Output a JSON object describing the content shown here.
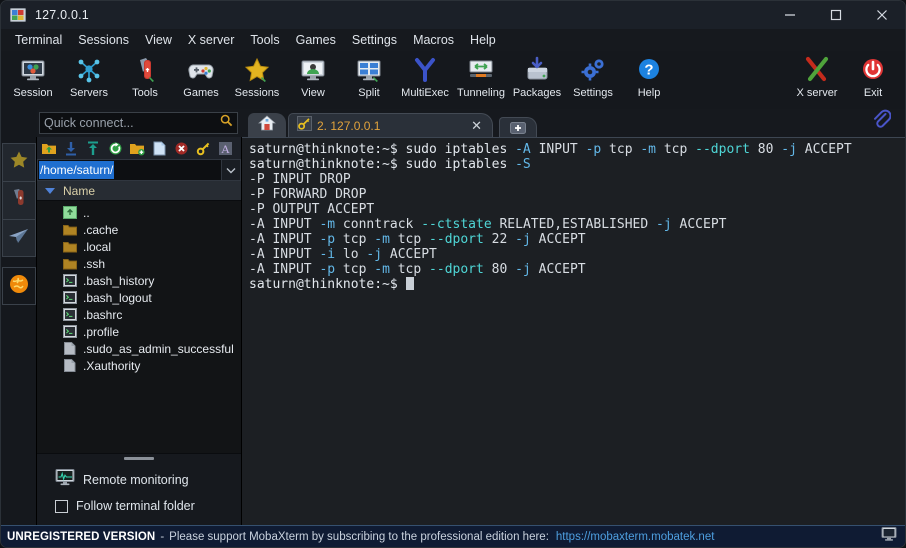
{
  "window": {
    "title": "127.0.0.1",
    "app_icon": "mobaxterm-logo-icon",
    "minimize": "—",
    "maximize": "□",
    "close": "✕"
  },
  "menubar": {
    "items": [
      {
        "label": "Terminal"
      },
      {
        "label": "Sessions"
      },
      {
        "label": "View"
      },
      {
        "label": "X server"
      },
      {
        "label": "Tools"
      },
      {
        "label": "Games"
      },
      {
        "label": "Settings"
      },
      {
        "label": "Macros"
      },
      {
        "label": "Help"
      }
    ]
  },
  "toolbar": {
    "items": [
      {
        "label": "Session",
        "icon": "monitor-session-icon"
      },
      {
        "label": "Servers",
        "icon": "servers-network-icon"
      },
      {
        "label": "Tools",
        "icon": "swiss-knife-icon"
      },
      {
        "label": "Games",
        "icon": "gamepad-icon"
      },
      {
        "label": "Sessions",
        "icon": "star-icon"
      },
      {
        "label": "View",
        "icon": "monitor-user-icon"
      },
      {
        "label": "Split",
        "icon": "split-panes-icon"
      },
      {
        "label": "MultiExec",
        "icon": "multiexec-fork-icon"
      },
      {
        "label": "Tunneling",
        "icon": "tunneling-arrows-icon"
      },
      {
        "label": "Packages",
        "icon": "packages-box-icon"
      },
      {
        "label": "Settings",
        "icon": "gears-icon"
      },
      {
        "label": "Help",
        "icon": "question-circle-icon"
      }
    ],
    "right_items": [
      {
        "label": "X server",
        "icon": "x-server-icon"
      },
      {
        "label": "Exit",
        "icon": "power-exit-icon"
      }
    ]
  },
  "rail": {
    "items": [
      {
        "name": "favorites",
        "icon": "star-icon"
      },
      {
        "name": "tools",
        "icon": "swiss-knife-icon"
      },
      {
        "name": "sftp",
        "icon": "paper-plane-icon"
      },
      {
        "name": "macros",
        "icon": "globe-icon"
      }
    ]
  },
  "quick_connect": {
    "placeholder": "Quick connect...",
    "value": "",
    "icon": "search-icon"
  },
  "sftp_panel": {
    "tool_icons": [
      {
        "name": "go-up-folder-icon"
      },
      {
        "name": "download-icon"
      },
      {
        "name": "upload-icon"
      },
      {
        "name": "refresh-icon"
      },
      {
        "name": "new-folder-icon"
      },
      {
        "name": "new-file-icon"
      },
      {
        "name": "delete-icon"
      },
      {
        "name": "permissions-key-icon"
      },
      {
        "name": "text-mode-icon"
      }
    ],
    "path": "/home/saturn/",
    "path_selected": true,
    "dropdown_caret": "⌄",
    "column_header": "Name",
    "files": [
      {
        "name": "..",
        "type": "parent"
      },
      {
        "name": ".cache",
        "type": "folder"
      },
      {
        "name": ".local",
        "type": "folder"
      },
      {
        "name": ".ssh",
        "type": "folder"
      },
      {
        "name": ".bash_history",
        "type": "script"
      },
      {
        "name": ".bash_logout",
        "type": "script"
      },
      {
        "name": ".bashrc",
        "type": "script"
      },
      {
        "name": ".profile",
        "type": "script"
      },
      {
        "name": ".sudo_as_admin_successful",
        "type": "file"
      },
      {
        "name": ".Xauthority",
        "type": "file"
      }
    ],
    "remote_monitoring_label": "Remote monitoring",
    "remote_monitoring_icon": "monitor-chart-icon",
    "follow_terminal_folder_label": "Follow terminal folder",
    "follow_terminal_folder_checked": false
  },
  "tabs": {
    "home_icon": "home-icon",
    "items": [
      {
        "label": "2. 127.0.0.1",
        "icon": "key-icon",
        "active": true,
        "close": "✕"
      }
    ],
    "add_label": "+",
    "clip_icon": "paperclip-icon"
  },
  "terminal": {
    "lines": [
      [
        {
          "t": "saturn@thinknote:~$ sudo iptables ",
          "c": "prompt"
        },
        {
          "t": "-A",
          "c": "flag"
        },
        {
          "t": " INPUT ",
          "c": "plain"
        },
        {
          "t": "-p",
          "c": "flag"
        },
        {
          "t": " tcp ",
          "c": "plain"
        },
        {
          "t": "-m",
          "c": "flag"
        },
        {
          "t": " tcp ",
          "c": "plain"
        },
        {
          "t": "--dport",
          "c": "long"
        },
        {
          "t": " 80 ",
          "c": "plain"
        },
        {
          "t": "-j",
          "c": "flag"
        },
        {
          "t": " ACCEPT",
          "c": "plain"
        }
      ],
      [
        {
          "t": "saturn@thinknote:~$ sudo iptables ",
          "c": "prompt"
        },
        {
          "t": "-S",
          "c": "flag"
        }
      ],
      [
        {
          "t": "-P INPUT DROP",
          "c": "plain"
        }
      ],
      [
        {
          "t": "-P FORWARD DROP",
          "c": "plain"
        }
      ],
      [
        {
          "t": "-P OUTPUT ACCEPT",
          "c": "plain"
        }
      ],
      [
        {
          "t": "-A INPUT ",
          "c": "plain"
        },
        {
          "t": "-m",
          "c": "flag"
        },
        {
          "t": " conntrack ",
          "c": "plain"
        },
        {
          "t": "--ctstate",
          "c": "long"
        },
        {
          "t": " RELATED,ESTABLISHED ",
          "c": "plain"
        },
        {
          "t": "-j",
          "c": "flag"
        },
        {
          "t": " ACCEPT",
          "c": "plain"
        }
      ],
      [
        {
          "t": "-A INPUT ",
          "c": "plain"
        },
        {
          "t": "-p",
          "c": "flag"
        },
        {
          "t": " tcp ",
          "c": "plain"
        },
        {
          "t": "-m",
          "c": "flag"
        },
        {
          "t": " tcp ",
          "c": "plain"
        },
        {
          "t": "--dport",
          "c": "long"
        },
        {
          "t": " 22 ",
          "c": "plain"
        },
        {
          "t": "-j",
          "c": "flag"
        },
        {
          "t": " ACCEPT",
          "c": "plain"
        }
      ],
      [
        {
          "t": "-A INPUT ",
          "c": "plain"
        },
        {
          "t": "-i",
          "c": "flag"
        },
        {
          "t": " lo ",
          "c": "plain"
        },
        {
          "t": "-j",
          "c": "flag"
        },
        {
          "t": " ACCEPT",
          "c": "plain"
        }
      ],
      [
        {
          "t": "-A INPUT ",
          "c": "plain"
        },
        {
          "t": "-p",
          "c": "flag"
        },
        {
          "t": " tcp ",
          "c": "plain"
        },
        {
          "t": "-m",
          "c": "flag"
        },
        {
          "t": " tcp ",
          "c": "plain"
        },
        {
          "t": "--dport",
          "c": "long"
        },
        {
          "t": " 80 ",
          "c": "plain"
        },
        {
          "t": "-j",
          "c": "flag"
        },
        {
          "t": " ACCEPT",
          "c": "plain"
        }
      ],
      [
        {
          "t": "saturn@thinknote:~$ ",
          "c": "prompt"
        },
        {
          "t": "",
          "c": "cursor"
        }
      ]
    ]
  },
  "statusbar": {
    "unregistered": "UNREGISTERED VERSION",
    "dash": "-",
    "message": "Please support MobaXterm by subscribing to the professional edition here:",
    "link": "https://mobaxterm.mobatek.net",
    "icon": "monitor-small-icon"
  },
  "colors": {
    "accent_blue": "#1f6fd0",
    "tab_text": "#e2a33c",
    "terminal_flag": "#63b8e8",
    "terminal_long": "#4fd6d6",
    "status_bg": "#0f1b33",
    "status_link": "#4e9fe0"
  }
}
